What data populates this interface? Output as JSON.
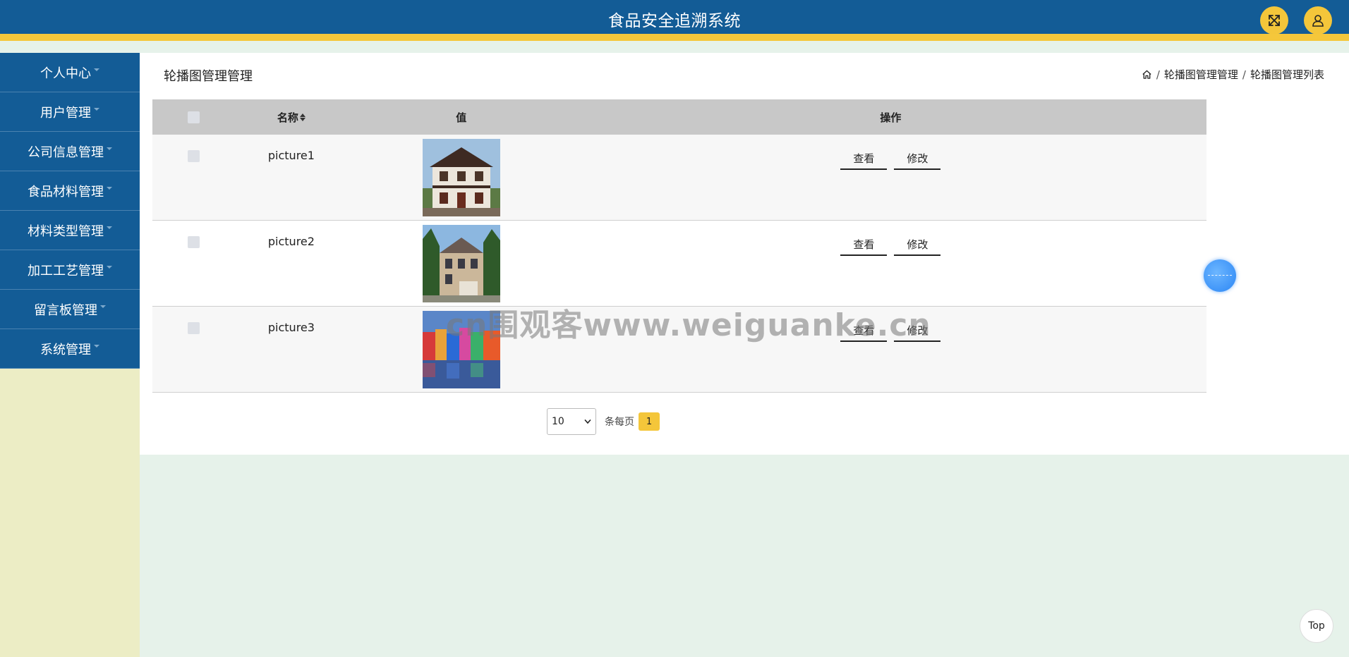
{
  "header": {
    "title": "食品安全追溯系统",
    "fullscreen_icon": "expand-icon",
    "user_icon": "user-icon",
    "bg_color": "#135c96",
    "accent_color": "#f5c73b"
  },
  "sidebar": {
    "items": [
      {
        "label": "个人中心"
      },
      {
        "label": "用户管理"
      },
      {
        "label": "公司信息管理"
      },
      {
        "label": "食品材料管理"
      },
      {
        "label": "材料类型管理"
      },
      {
        "label": "加工工艺管理"
      },
      {
        "label": "留言板管理"
      },
      {
        "label": "系统管理"
      }
    ]
  },
  "main": {
    "title": "轮播图管理管理",
    "breadcrumb": {
      "home_icon": "home-icon",
      "items": [
        "轮播图管理管理",
        "轮播图管理列表"
      ]
    },
    "table": {
      "headers": {
        "name": "名称",
        "value": "值",
        "actions": "操作"
      },
      "rows": [
        {
          "name": "picture1",
          "image": "house-photo-1",
          "view": "查看",
          "edit": "修改"
        },
        {
          "name": "picture2",
          "image": "house-photo-2",
          "view": "查看",
          "edit": "修改"
        },
        {
          "name": "picture3",
          "image": "colorful-houses-photo",
          "view": "查看",
          "edit": "修改"
        }
      ]
    },
    "pagination": {
      "page_size": "10",
      "per_page_label": "条每页",
      "current_page": "1"
    }
  },
  "watermark": "cn围观客www.weiguanke.cn",
  "float_button_icon": "assistant-ball-icon",
  "top_button": "Top"
}
